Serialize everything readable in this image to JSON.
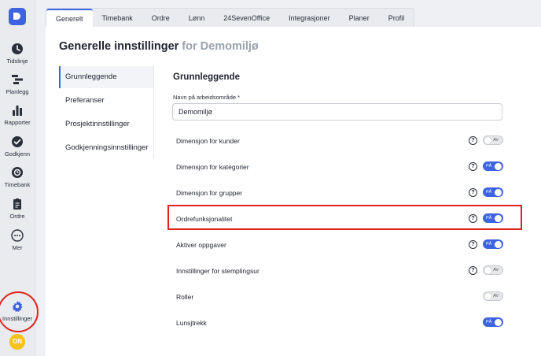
{
  "nav": {
    "items": [
      {
        "label": "Tidslinje",
        "icon": "clock-icon"
      },
      {
        "label": "Planlegg",
        "icon": "gantt-icon"
      },
      {
        "label": "Rapporter",
        "icon": "bar-chart-icon"
      },
      {
        "label": "Godkjenn",
        "icon": "check-circle-icon"
      },
      {
        "label": "Timebank",
        "icon": "timebank-icon"
      },
      {
        "label": "Ordre",
        "icon": "clipboard-icon"
      },
      {
        "label": "Mer",
        "icon": "more-icon"
      },
      {
        "label": "Innstillinger",
        "icon": "gear-icon"
      }
    ],
    "badge": "ON"
  },
  "tabs": [
    "Generelt",
    "Timebank",
    "Ordre",
    "Lønn",
    "24SevenOffice",
    "Integrasjoner",
    "Planer",
    "Profil"
  ],
  "page": {
    "title": "Generelle innstillinger",
    "subtitle": "for Demomiljø"
  },
  "subnav": [
    "Grunnleggende",
    "Preferanser",
    "Prosjektinnstillinger",
    "Godkjenningsinnstillinger"
  ],
  "section": {
    "title": "Grunnleggende",
    "field_label": "Navn på arbeidsområde *",
    "field_value": "Demomiljø"
  },
  "settings": [
    {
      "label": "Dimensjon for kunder",
      "state": "AV",
      "help": true
    },
    {
      "label": "Dimensjon for kategorier",
      "state": "PÅ",
      "help": true
    },
    {
      "label": "Dimensjon for grupper",
      "state": "PÅ",
      "help": true
    },
    {
      "label": "Ordrefunksjonalitet",
      "state": "PÅ",
      "help": true
    },
    {
      "label": "Aktiver oppgaver",
      "state": "PÅ",
      "help": true
    },
    {
      "label": "Innstillinger for stemplingsur",
      "state": "AV",
      "help": true
    },
    {
      "label": "Roller",
      "state": "AV",
      "help": false
    },
    {
      "label": "Lunsjtrekk",
      "state": "PÅ",
      "help": false
    }
  ],
  "help_glyph": "?",
  "colors": {
    "accent": "#3d63e0",
    "highlight": "#e0231a",
    "badge": "#f6c219"
  }
}
